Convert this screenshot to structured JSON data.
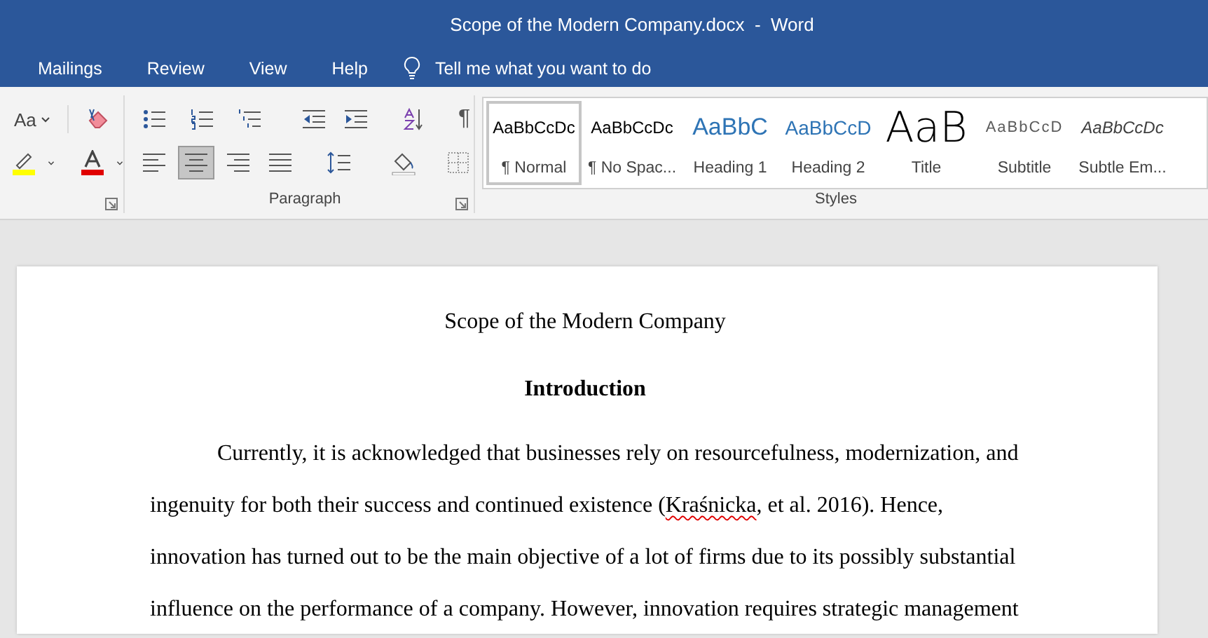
{
  "window": {
    "title": "Scope of the Modern Company.docx  -  Word"
  },
  "ribbon_tabs": [
    {
      "label": "Mailings",
      "selected": false
    },
    {
      "label": "Review",
      "selected": false
    },
    {
      "label": "View",
      "selected": false
    },
    {
      "label": "Help",
      "selected": false
    }
  ],
  "tell_me": {
    "label": "Tell me what you want to do"
  },
  "font_group": {
    "change_case": "Aa"
  },
  "paragraph_group": {
    "label": "Paragraph",
    "show_marks": "¶",
    "alignment": [
      {
        "kind": "left",
        "selected": false
      },
      {
        "kind": "center",
        "selected": true
      },
      {
        "kind": "right",
        "selected": false
      },
      {
        "kind": "justify",
        "selected": false
      }
    ]
  },
  "styles_group": {
    "label": "Styles",
    "styles": [
      {
        "kind": "normal",
        "preview": "AaBbCcDc",
        "name": "¶ Normal",
        "selected": true
      },
      {
        "kind": "no-spacing",
        "preview": "AaBbCcDc",
        "name": "¶ No Spac...",
        "selected": false
      },
      {
        "kind": "heading1",
        "preview": "AaBbC",
        "name": "Heading 1",
        "selected": false
      },
      {
        "kind": "heading2",
        "preview": "AaBbCcD",
        "name": "Heading 2",
        "selected": false
      },
      {
        "kind": "title",
        "preview": "AaB",
        "name": "Title",
        "selected": false
      },
      {
        "kind": "subtitle",
        "preview": "AaBbCcD",
        "name": "Subtitle",
        "selected": false
      },
      {
        "kind": "subtle-emphasis",
        "preview": "AaBbCcDc",
        "name": "Subtle Em...",
        "selected": false
      }
    ]
  },
  "document": {
    "title": "Scope of the Modern Company",
    "heading": "Introduction",
    "paragraph": [
      {
        "text": "Currently, it is acknowledged that businesses rely on resourcefulness, modernization, and ingenuity for both their success and continued existence (",
        "misspelled": false
      },
      {
        "text": "Kraśnicka",
        "misspelled": true
      },
      {
        "text": ", et al. 2016). Hence, innovation has turned out to be the main objective of a lot of firms due to its possibly substantial influence on the performance of a company. However, innovation requires strategic management",
        "misspelled": false
      }
    ]
  }
}
